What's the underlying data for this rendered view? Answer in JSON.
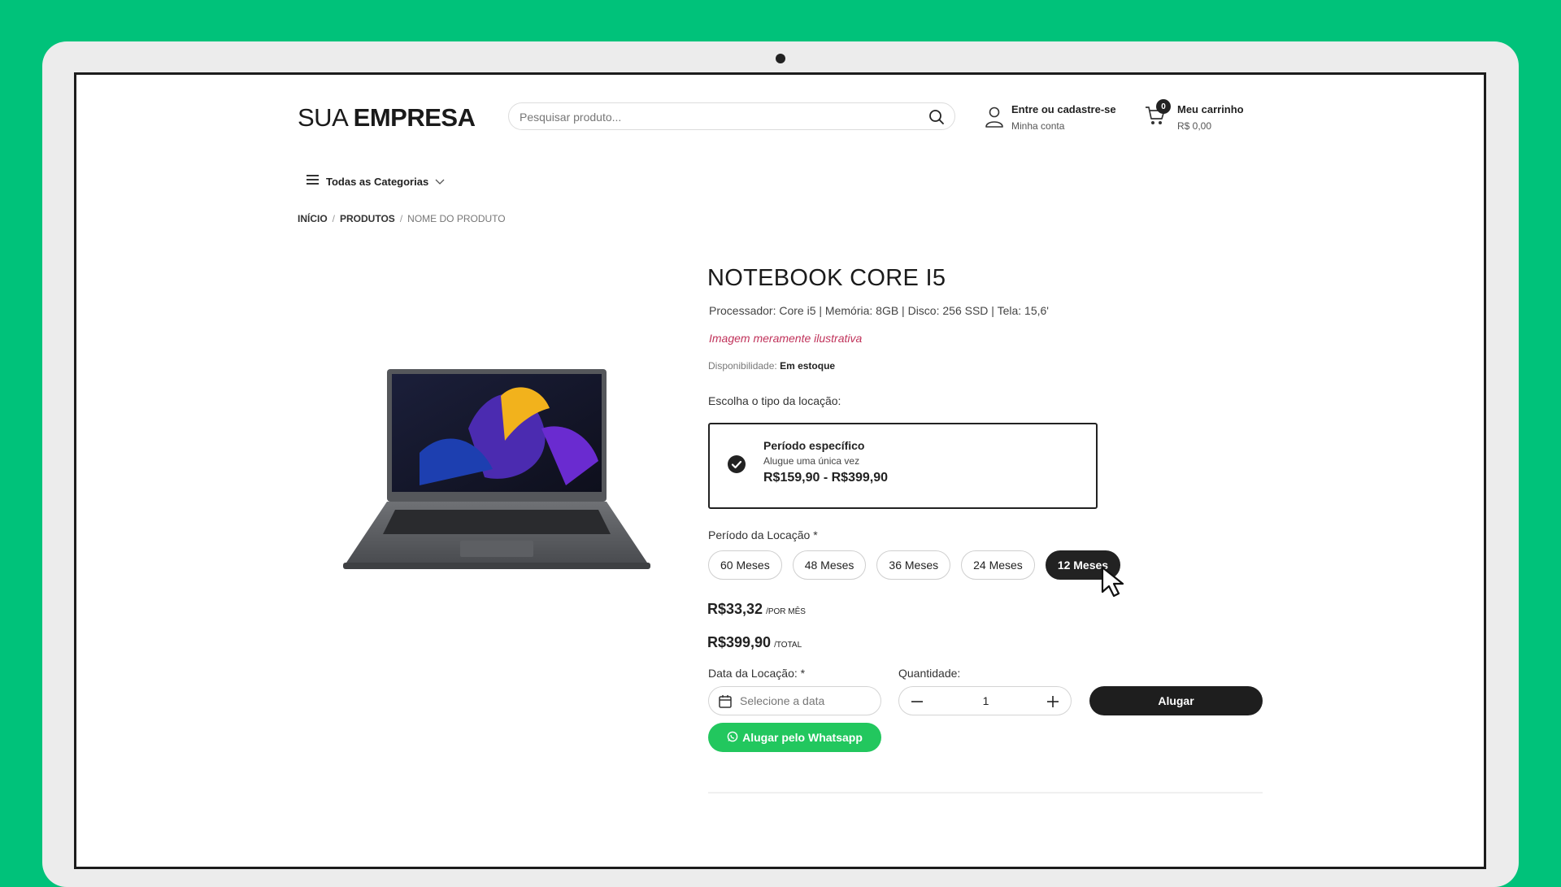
{
  "header": {
    "logo_part1": "SUA",
    "logo_part2": "EMPRESA",
    "search_placeholder": "Pesquisar produto...",
    "account_title": "Entre ou cadastre-se",
    "account_sub": "Minha conta",
    "cart_title": "Meu carrinho",
    "cart_total": "R$ 0,00",
    "cart_count": "0"
  },
  "nav": {
    "categories_label": "Todas as Categorias"
  },
  "breadcrumb": {
    "items": [
      "INÍCIO",
      "PRODUTOS"
    ],
    "current": "NOME DO PRODUTO"
  },
  "product": {
    "title": "NOTEBOOK CORE I5",
    "specs": "Processador: Core i5 | Memória: 8GB | Disco: 256 SSD | Tela: 15,6'",
    "note": "Imagem meramente ilustrativa",
    "availability_label": "Disponibilidade:",
    "availability_value": "Em estoque",
    "rental_type_label": "Escolha o tipo da locação:",
    "option": {
      "title": "Período específico",
      "subtitle": "Alugue uma única vez",
      "price_range": "R$159,90 - R$399,90"
    },
    "period_label": "Período da Locação *",
    "periods": [
      "60 Meses",
      "48 Meses",
      "36 Meses",
      "24 Meses",
      "12 Meses"
    ],
    "selected_period": "12 Meses",
    "monthly_price": "R$33,32",
    "monthly_unit": "/POR MÊS",
    "total_price": "R$399,90",
    "total_unit": "/TOTAL",
    "date_label": "Data da Locação: *",
    "date_placeholder": "Selecione a data",
    "quantity_label": "Quantidade:",
    "quantity": "1",
    "rent_button": "Alugar",
    "whatsapp_button": "Alugar pelo Whatsapp"
  },
  "colors": {
    "background": "#00c27a",
    "accent_dark": "#1e1e1e",
    "whatsapp": "#22c75e",
    "note": "#c0325a"
  }
}
